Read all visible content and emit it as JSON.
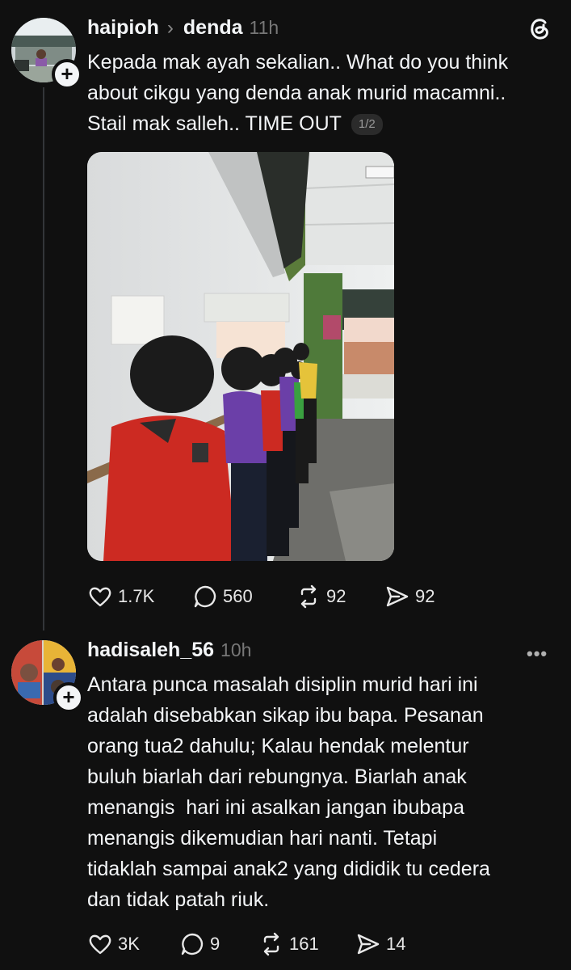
{
  "post": {
    "username": "haipioh",
    "topic": "denda",
    "time": "11h",
    "text_lines": [
      "Kepada mak ayah sekalian.. What do you think",
      "about cikgu yang denda anak murid macamni..",
      "Stail mak salleh.. TIME OUT"
    ],
    "image_counter": "1/2",
    "stats": {
      "likes": "1.7K",
      "replies": "560",
      "reposts": "92",
      "shares": "92"
    }
  },
  "reply": {
    "username": "hadisaleh_56",
    "time": "10h",
    "text_lines": [
      "Antara punca masalah disiplin murid hari ini",
      "adalah disebabkan sikap ibu bapa. Pesanan",
      "orang tua2 dahulu; Kalau hendak melentur",
      "buluh biarlah dari rebungnya. Biarlah anak",
      "menangis  hari ini asalkan jangan ibubapa",
      "menangis dikemudian hari nanti. Tetapi",
      "tidaklah sampai anak2 yang dididik tu cedera",
      "dan tidak patah riuk."
    ],
    "stats": {
      "likes": "3K",
      "replies": "9",
      "reposts": "161",
      "shares": "14"
    }
  },
  "icons": {
    "follow": "+",
    "chevron": "›",
    "more": "•••"
  },
  "colors": {
    "background": "#101010",
    "text": "#f3f5f7",
    "muted": "#777777"
  }
}
